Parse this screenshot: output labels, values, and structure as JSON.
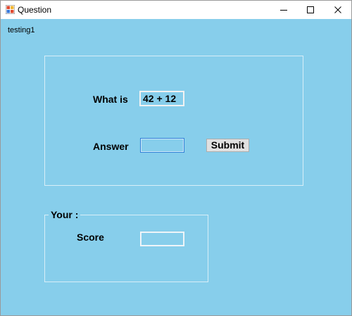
{
  "window": {
    "title": "Question",
    "app_icon": "winforms-app-icon",
    "controls": [
      "minimize-icon",
      "maximize-icon",
      "close-icon"
    ]
  },
  "client": {
    "label": "testing1"
  },
  "question_group": {
    "question_label": "What is",
    "question_value": "42 + 12",
    "answer_label": "Answer",
    "answer_value": "",
    "submit_label": "Submit"
  },
  "score_group": {
    "legend": "Your :",
    "score_label": "Score",
    "score_value": ""
  },
  "colors": {
    "background": "#87ceeb",
    "titlebar": "#ffffff",
    "button_face": "#e1e1e1",
    "focus_border": "#2f80d6"
  }
}
